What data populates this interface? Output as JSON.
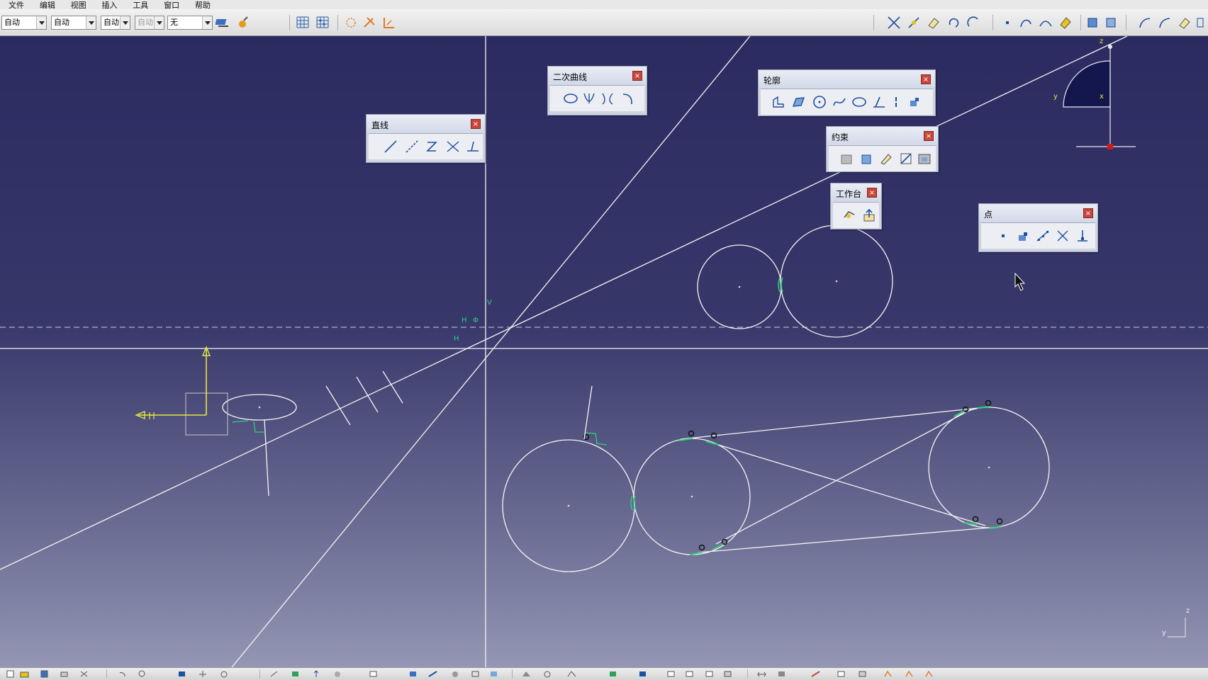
{
  "menu": [
    "文件",
    "编辑",
    "视图",
    "插入",
    "工具",
    "窗口",
    "帮助"
  ],
  "toolbar": {
    "combo1": "自动",
    "combo2": "自动",
    "combo3": "自动",
    "combo4": "自动",
    "combo5": "无"
  },
  "panels": {
    "line": {
      "title": "直线",
      "close": "×"
    },
    "conic": {
      "title": "二次曲线",
      "close": "×"
    },
    "profile": {
      "title": "轮廓",
      "close": "×"
    },
    "constraint": {
      "title": "约束",
      "close": "×"
    },
    "workbench": {
      "title": "工作台",
      "close": "×"
    },
    "point": {
      "title": "点",
      "close": "×"
    }
  },
  "canvas_labels": {
    "v": "V",
    "h1": "H",
    "h2": "H",
    "phi": "Φ",
    "compass_z": "z",
    "compass_y": "y",
    "compass_x": "x",
    "axis_z": "z",
    "axis_y": "y"
  },
  "colors": {
    "sketch_white": "#ffffff",
    "axis_yellow": "#e6e640",
    "constraint_green": "#2fd07a",
    "background_top": "#2b2b61",
    "background_bottom": "#9496b4"
  }
}
